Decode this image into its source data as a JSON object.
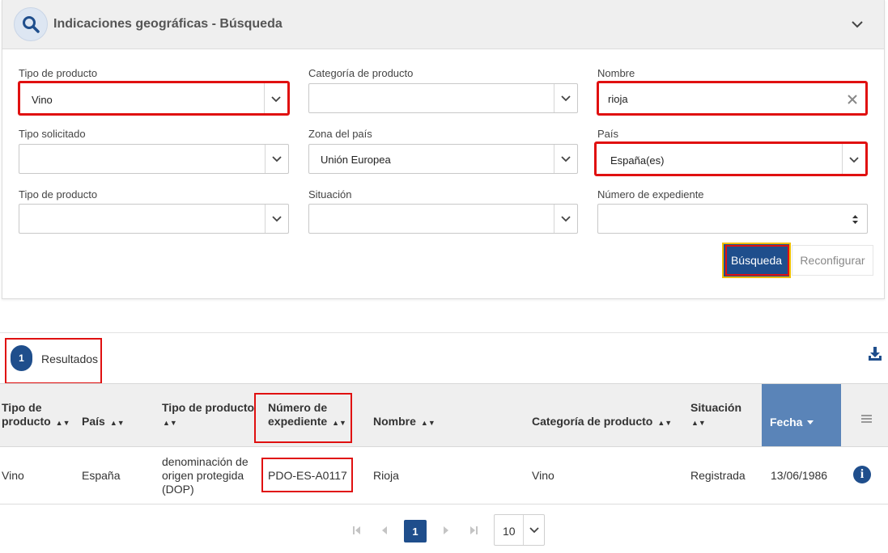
{
  "panel": {
    "title": "Indicaciones geográficas - Búsqueda"
  },
  "form": {
    "tipo_producto_1": {
      "label": "Tipo de producto",
      "value": "Vino"
    },
    "categoria": {
      "label": "Categoría de producto",
      "value": ""
    },
    "nombre": {
      "label": "Nombre",
      "value": "rioja"
    },
    "tipo_solicitado": {
      "label": "Tipo solicitado",
      "value": ""
    },
    "zona": {
      "label": "Zona del país",
      "value": "Unión Europea"
    },
    "pais": {
      "label": "País",
      "value": "España(es)"
    },
    "tipo_producto_2": {
      "label": "Tipo de producto",
      "value": ""
    },
    "situacion": {
      "label": "Situación",
      "value": ""
    },
    "expediente": {
      "label": "Número de expediente",
      "value": ""
    }
  },
  "buttons": {
    "search": "Búsqueda",
    "reset": "Reconfigurar"
  },
  "results": {
    "count": "1",
    "label": "Resultados"
  },
  "table": {
    "headers": {
      "tipo_1": "Tipo de",
      "tipo_2": "producto",
      "pais": "País",
      "tipo_producto": "Tipo de producto",
      "num_1": "Número de",
      "num_2": "expediente",
      "nombre": "Nombre",
      "categoria": "Categoría de producto",
      "situacion": "Situación",
      "fecha": "Fecha"
    },
    "row": {
      "tipo": "Vino",
      "pais": "España",
      "tipo_producto_1": "denominación de",
      "tipo_producto_2": "origen protegida",
      "tipo_producto_3": "(DOP)",
      "expediente": "PDO-ES-A0117",
      "nombre": "Rioja",
      "categoria": "Vino",
      "situacion": "Registrada",
      "fecha": "13/06/1986"
    }
  },
  "pagination": {
    "current": "1",
    "page_size": "10"
  },
  "colors": {
    "primary": "#1f4e8c",
    "highlight": "#e01010",
    "sorted_header": "#5a84b8"
  }
}
